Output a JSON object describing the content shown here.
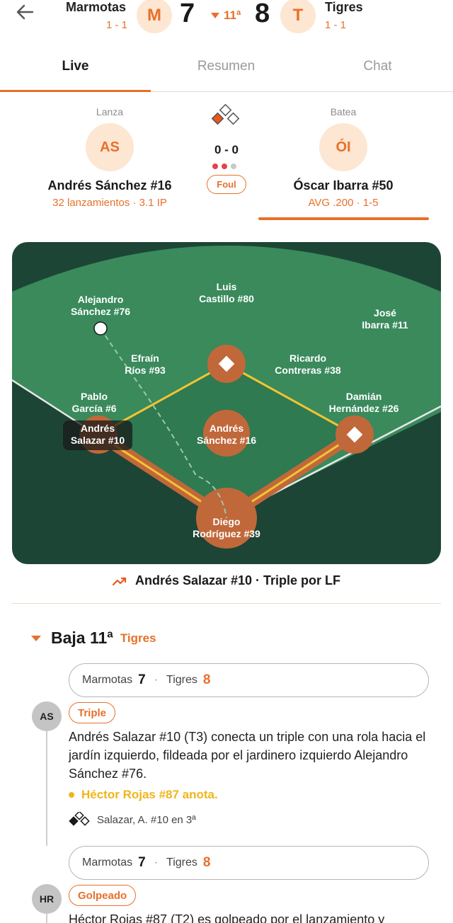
{
  "header": {
    "away": {
      "name": "Marmotas",
      "record": "1 - 1",
      "logo": "M",
      "score": "7"
    },
    "home": {
      "name": "Tigres",
      "record": "1 - 1",
      "logo": "T",
      "score": "8"
    },
    "inning": "11ª"
  },
  "tabs": [
    "Live",
    "Resumen",
    "Chat"
  ],
  "matchup": {
    "pitcher": {
      "role": "Lanza",
      "initials": "AS",
      "name": "Andrés Sánchez #16",
      "stat": "32 lanzamientos · 3.1 IP"
    },
    "batter": {
      "role": "Batea",
      "initials": "ÓI",
      "name": "Óscar Ibarra #50",
      "stat": "AVG .200 · 1-5"
    },
    "count": "0 - 0",
    "outs": 2,
    "last_pitch": "Foul"
  },
  "field": {
    "players": {
      "lf": "Alejandro\nSánchez #76",
      "cf": "Luis\nCastillo #80",
      "rf": "José\nIbarra #11",
      "ss": "Efraín\nRíos #93",
      "second": "Ricardo\nContreras #38",
      "third": "Pablo\nGarcía #6",
      "first": "Damián\nHernández #26",
      "runner_third": "Andrés\nSalazar #10",
      "pitcher": "Andrés\nSánchez #16",
      "catcher": "Diego\nRodríguez #39"
    }
  },
  "last_play": "Andrés Salazar #10 · Triple por LF",
  "feed": {
    "half_label": "Baja 11ª",
    "half_team": "Tigres",
    "events": [
      {
        "score": {
          "away_name": "Marmotas",
          "away": "7",
          "home_name": "Tigres",
          "home": "8"
        },
        "avatar": "AS",
        "tag": "Triple",
        "description": "Andrés Salazar #10 (T3) conecta un triple con una rola hacia el jardín izquierdo, fildeada por el jardinero izquierdo Alejandro Sánchez #76.",
        "scored": "Héctor Rojas #87 anota.",
        "runner": "Salazar, A. #10 en 3ª"
      },
      {
        "score": {
          "away_name": "Marmotas",
          "away": "7",
          "home_name": "Tigres",
          "home": "8"
        },
        "avatar": "HR",
        "tag": "Golpeado",
        "description": "Héctor Rojas #87 (T2) es golpeado por el lanzamiento y"
      }
    ]
  },
  "colors": {
    "accent": "#e8702a",
    "field_dark": "#1d4535",
    "field_light": "#3a8a5c",
    "dirt": "#c0683a",
    "base_path": "#f4c430"
  }
}
